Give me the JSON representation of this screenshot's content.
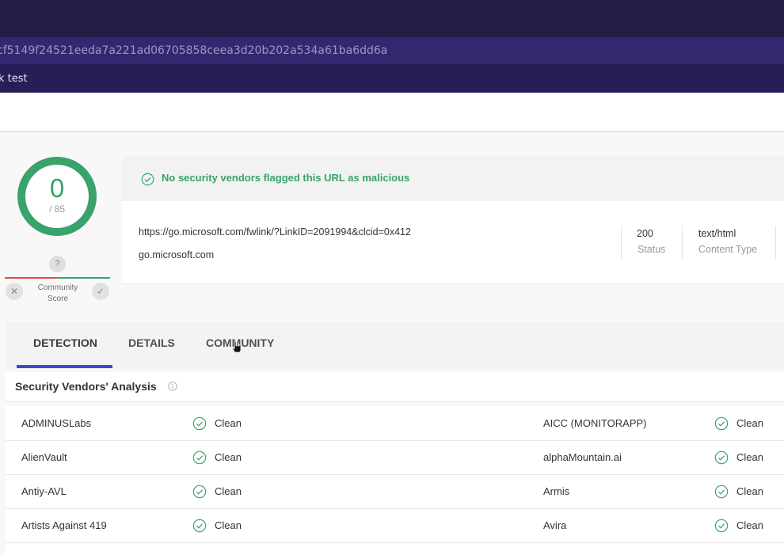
{
  "header": {
    "hash": "cf5149f24521eeda7a221ad06705858ceea3d20b202a534a61ba6dd6a",
    "name": "k test"
  },
  "score": {
    "value": "0",
    "total": "/ 85",
    "community_question": "?",
    "community_label_line1": "Community",
    "community_label_line2": "Score"
  },
  "verdict": {
    "text": "No security vendors flagged this URL as malicious",
    "color": "#3aa26b"
  },
  "url_info": {
    "url": "https://go.microsoft.com/fwlink/?LinkID=2091994&clcid=0x412",
    "host": "go.microsoft.com",
    "status_value": "200",
    "status_label": "Status",
    "content_type_value": "text/html",
    "content_type_label": "Content Type"
  },
  "tabs": [
    {
      "label": "DETECTION",
      "active": true
    },
    {
      "label": "DETAILS",
      "active": false
    },
    {
      "label": "COMMUNITY",
      "active": false
    }
  ],
  "analysis": {
    "title": "Security Vendors' Analysis",
    "rows": [
      {
        "left_vendor": "ADMINUSLabs",
        "left_status": "Clean",
        "right_vendor": "AICC (MONITORAPP)",
        "right_status": "Clean"
      },
      {
        "left_vendor": "AlienVault",
        "left_status": "Clean",
        "right_vendor": "alphaMountain.ai",
        "right_status": "Clean"
      },
      {
        "left_vendor": "Antiy-AVL",
        "left_status": "Clean",
        "right_vendor": "Armis",
        "right_status": "Clean"
      },
      {
        "left_vendor": "Artists Against 419",
        "left_status": "Clean",
        "right_vendor": "Avira",
        "right_status": "Clean"
      }
    ]
  },
  "colors": {
    "accent": "#3a4ad1",
    "clean": "#3aa26b",
    "header_dark": "#251c45"
  }
}
